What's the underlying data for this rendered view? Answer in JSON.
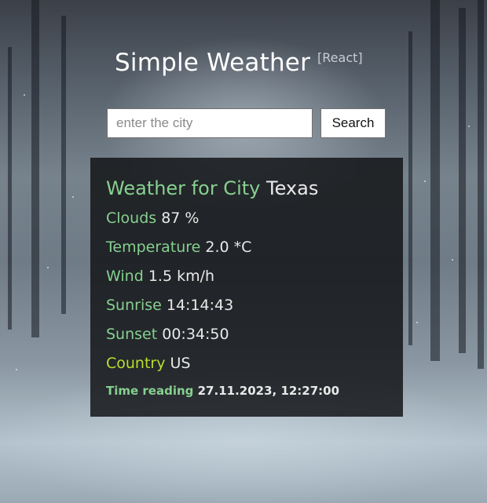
{
  "app": {
    "title": "Simple Weather",
    "badge": "[React]"
  },
  "search": {
    "placeholder": "enter the city",
    "value": "",
    "button_label": "Search"
  },
  "weather": {
    "header_label": "Weather for City",
    "city": "Texas",
    "clouds_label": "Clouds",
    "clouds_value": "87 %",
    "temperature_label": "Temperature",
    "temperature_value": "2.0 *C",
    "wind_label": "Wind",
    "wind_value": "1.5 km/h",
    "sunrise_label": "Sunrise",
    "sunrise_value": "14:14:43",
    "sunset_label": "Sunset",
    "sunset_value": "00:34:50",
    "country_label": "Country",
    "country_value": "US",
    "time_label": "Time reading",
    "time_value": "27.11.2023, 12:27:00"
  },
  "colors": {
    "label_green": "#86d090",
    "country_label": "#b7e02e",
    "panel_bg": "rgba(18,19,22,0.84)",
    "value_text": "#e9e9e9"
  }
}
